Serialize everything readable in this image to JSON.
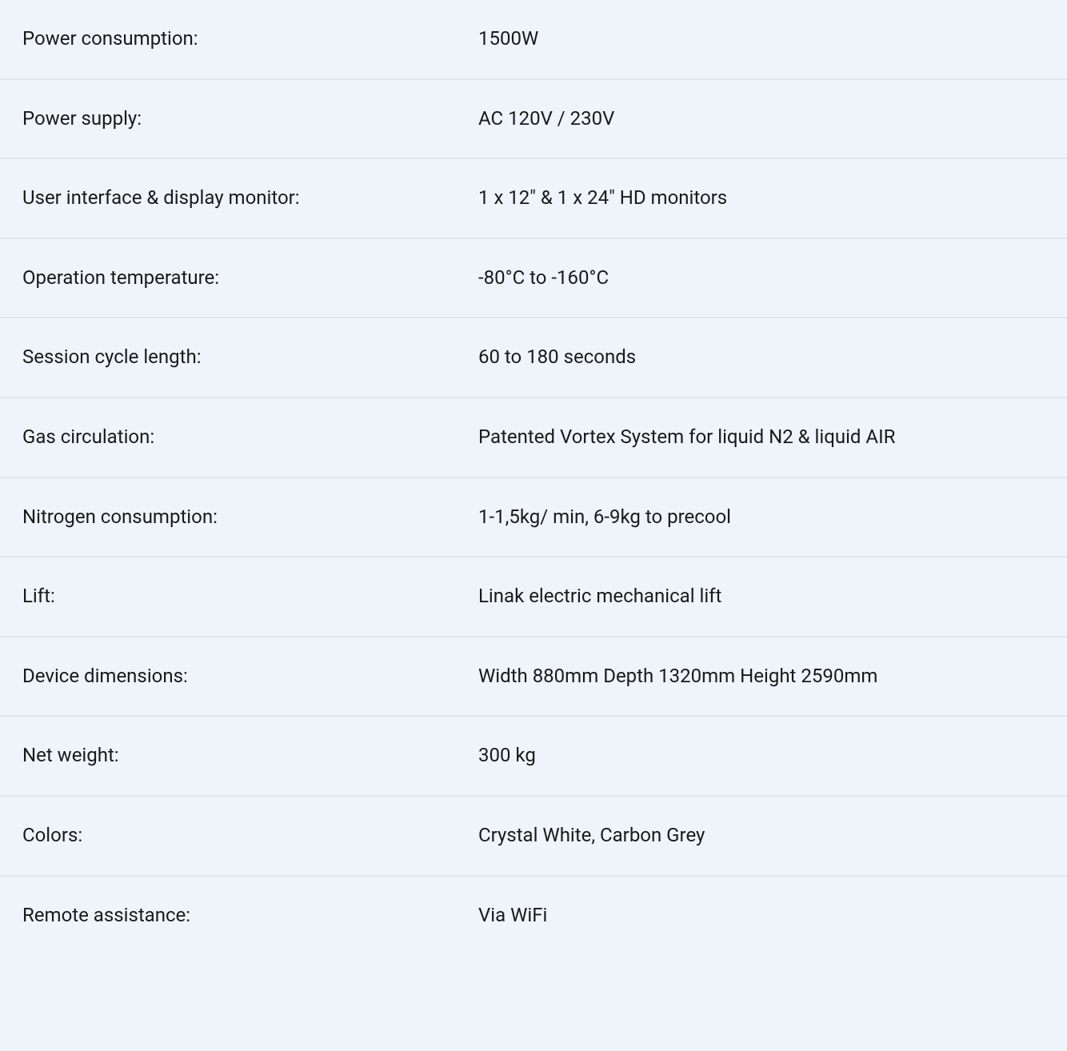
{
  "specs": [
    {
      "label": "Power consumption:",
      "value": "1500W"
    },
    {
      "label": "Power supply:",
      "value": "AC 120V / 230V"
    },
    {
      "label": "User interface & display monitor:",
      "value": "1 x 12\" & 1 x 24\" HD monitors"
    },
    {
      "label": "Operation temperature:",
      "value": "-80°C to -160°C"
    },
    {
      "label": "Session cycle length:",
      "value": "60 to 180 seconds"
    },
    {
      "label": "Gas circulation:",
      "value": "Patented Vortex System for liquid N2 & liquid AIR"
    },
    {
      "label": "Nitrogen consumption:",
      "value": "1-1,5kg/ min, 6-9kg to precool"
    },
    {
      "label": "Lift:",
      "value": "Linak electric mechanical lift"
    },
    {
      "label": "Device dimensions:",
      "value": "Width 880mm Depth 1320mm Height 2590mm"
    },
    {
      "label": "Net weight:",
      "value": "300 kg"
    },
    {
      "label": "Colors:",
      "value": "Crystal White, Carbon Grey"
    },
    {
      "label": "Remote assistance:",
      "value": "Via WiFi"
    }
  ]
}
